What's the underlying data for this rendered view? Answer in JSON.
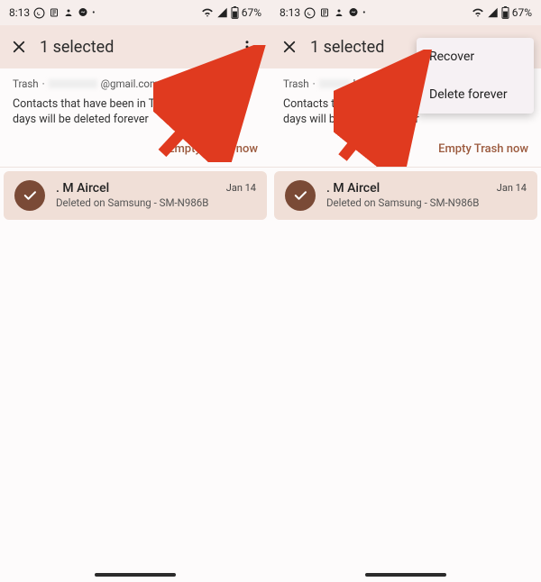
{
  "status": {
    "time": "8:13",
    "battery": "67%"
  },
  "selbar": {
    "title": "1 selected"
  },
  "account": {
    "prefix": "Trash",
    "sep": " · ",
    "suffix": "@gmail.com"
  },
  "notice": "Contacts that have been in Trash more than 30 days will be deleted forever",
  "empty_link": "Empty Trash now",
  "contact": {
    "name": ". M Aircel",
    "sub": "Deleted on Samsung - SM-N986B",
    "date": "Jan 14"
  },
  "popup": {
    "recover": "Recover",
    "delete": "Delete forever"
  }
}
